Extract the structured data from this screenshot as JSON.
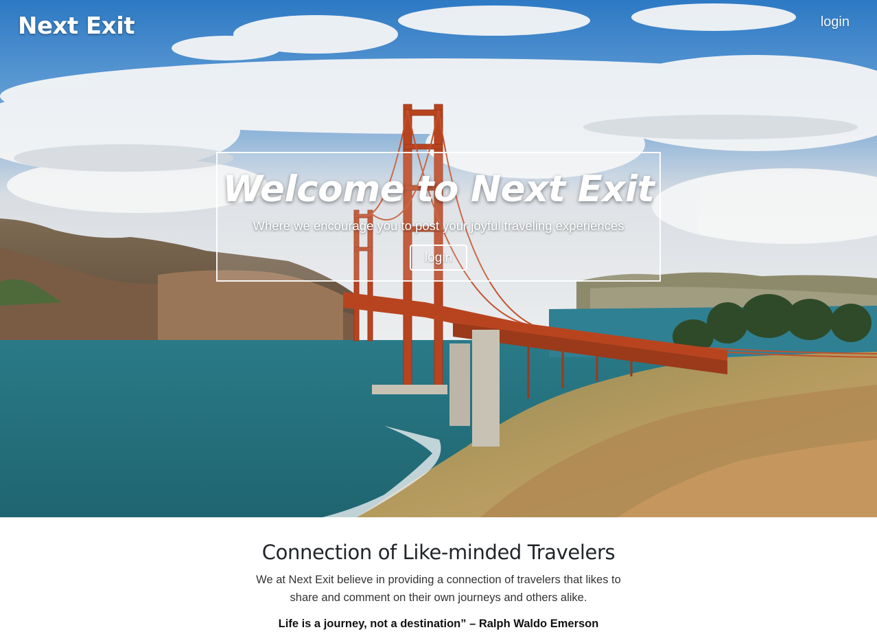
{
  "header": {
    "brand": "Next Exit",
    "login_link": "login"
  },
  "hero": {
    "title": "Welcome to Next Exit",
    "subtitle": "Where we encourage you to post your joyful traveling experiences",
    "button_label": "login",
    "image_subject": "golden-gate-bridge-photo"
  },
  "about": {
    "heading": "Connection of Like-minded Travelers",
    "body": "We at Next Exit believe in providing a connection of travelers that likes to share and comment on their own journeys and others alike.",
    "quote": "Life is a journey, not a destination” – Ralph Waldo Emerson"
  },
  "colors": {
    "sky": "#3f86c9",
    "water": "#2f7a84",
    "bridge": "#b8441f",
    "text_dark": "#212529"
  }
}
